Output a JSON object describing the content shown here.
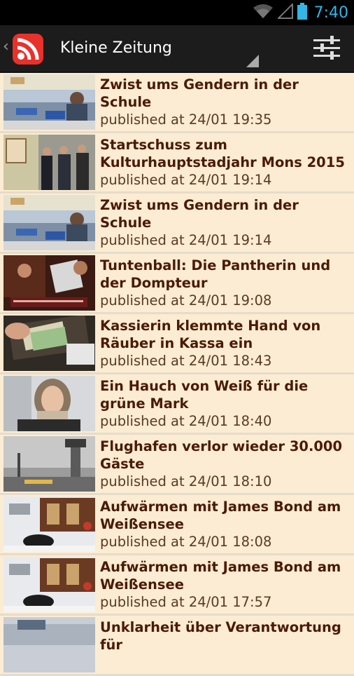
{
  "status_bar": {
    "time": "7:40",
    "accent": "#33b5e5"
  },
  "action_bar": {
    "title": "Kleine Zeitung",
    "logo_icon": "rss-logo-icon",
    "settings_icon": "sliders-icon"
  },
  "colors": {
    "list_bg": "#fbecd3",
    "title": "#4b1a05",
    "meta": "#5a3a24"
  },
  "articles": [
    {
      "title": "Zwist ums Gendern in der Schule",
      "meta": "published at 24/01 19:35"
    },
    {
      "title": "Startschuss zum Kulturhauptstadjahr Mons 2015",
      "meta": "published at 24/01 19:14"
    },
    {
      "title": "Zwist ums Gendern in der Schule",
      "meta": "published at 24/01 19:14"
    },
    {
      "title": "Tuntenball: Die Pantherin und der Dompteur",
      "meta": "published at 24/01 19:08"
    },
    {
      "title": "Kassierin klemmte Hand von Räuber in Kassa ein",
      "meta": "published at 24/01 18:43"
    },
    {
      "title": "Ein Hauch von Weiß für die grüne Mark",
      "meta": "published at 24/01 18:40"
    },
    {
      "title": "Flughafen verlor wieder 30.000 Gäste",
      "meta": "published at 24/01 18:10"
    },
    {
      "title": "Aufwärmen mit James Bond am Weißensee",
      "meta": "published at 24/01 18:08"
    },
    {
      "title": "Aufwärmen mit James Bond am Weißensee",
      "meta": "published at 24/01 17:57"
    },
    {
      "title": "Unklarheit über Verantwortung für",
      "meta": ""
    }
  ]
}
